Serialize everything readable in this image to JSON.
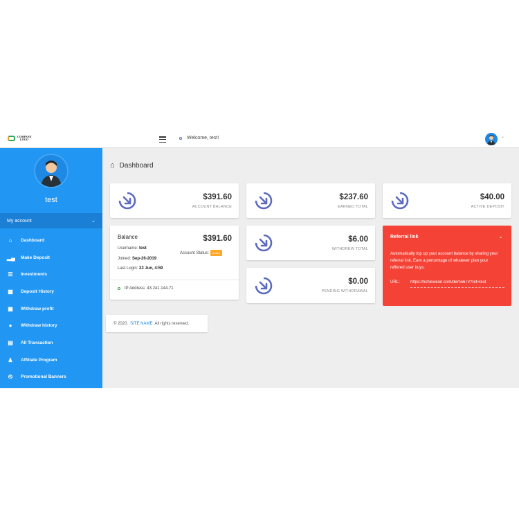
{
  "brand": {
    "logo_text_1": "COMPANY",
    "logo_text_2": "LOGO"
  },
  "header": {
    "welcome": "Welcome, test!"
  },
  "sidebar": {
    "username": "test",
    "account_label": "My account",
    "items": [
      {
        "label": "Dashboard",
        "icon": "home-icon"
      },
      {
        "label": "Make Deposit",
        "icon": "bar-chart-icon"
      },
      {
        "label": "Investments",
        "icon": "list-icon"
      },
      {
        "label": "Deposit History",
        "icon": "folder-icon"
      },
      {
        "label": "Withdraw profit",
        "icon": "money-icon"
      },
      {
        "label": "Withdraw history",
        "icon": "piggy-bank-icon"
      },
      {
        "label": "All Transaction",
        "icon": "transaction-icon"
      },
      {
        "label": "Affiliate Program",
        "icon": "users-icon"
      },
      {
        "label": "Promotional Banners",
        "icon": "paperclip-icon"
      }
    ]
  },
  "page": {
    "title": "Dashboard"
  },
  "stats": [
    {
      "value": "$391.60",
      "label": "ACCOUNT BALANCE"
    },
    {
      "value": "$237.60",
      "label": "EARNED TOTAL"
    },
    {
      "value": "$40.00",
      "label": "ACTIVE DEPOSIT"
    },
    {
      "value": "$6.00",
      "label": "WITHDREW TOTAL"
    },
    {
      "value": "$0.00",
      "label": "PENDING WITHDRAWAL"
    }
  ],
  "balance": {
    "title": "Balance",
    "value": "$391.60",
    "username_label": "Username:",
    "username": "test",
    "joined_label": "Joined:",
    "joined": "Sep-26-2019",
    "last_login_label": "Last Login:",
    "last_login": "22 Jun, 4:59",
    "status_label": "Account Status:",
    "status": "Active",
    "ip_label": "IP Address:",
    "ip": "43.241.144.71"
  },
  "referral": {
    "title": "Referral link",
    "text": "Automatically top up your account balance by sharing your referral link, Earn a percentage of whatever plan your reffered user buys.",
    "url_label": "URL:",
    "url": "https://richlexicon.com/demo67//?ref=test"
  },
  "footer": {
    "prefix": "© 2020.",
    "link": "SITE NAME",
    "suffix": "All rights reserved."
  },
  "colors": {
    "sidebar": "#2196f3",
    "referral": "#f44336",
    "accent": "#5c6bc0",
    "badge": "#ffa726"
  }
}
